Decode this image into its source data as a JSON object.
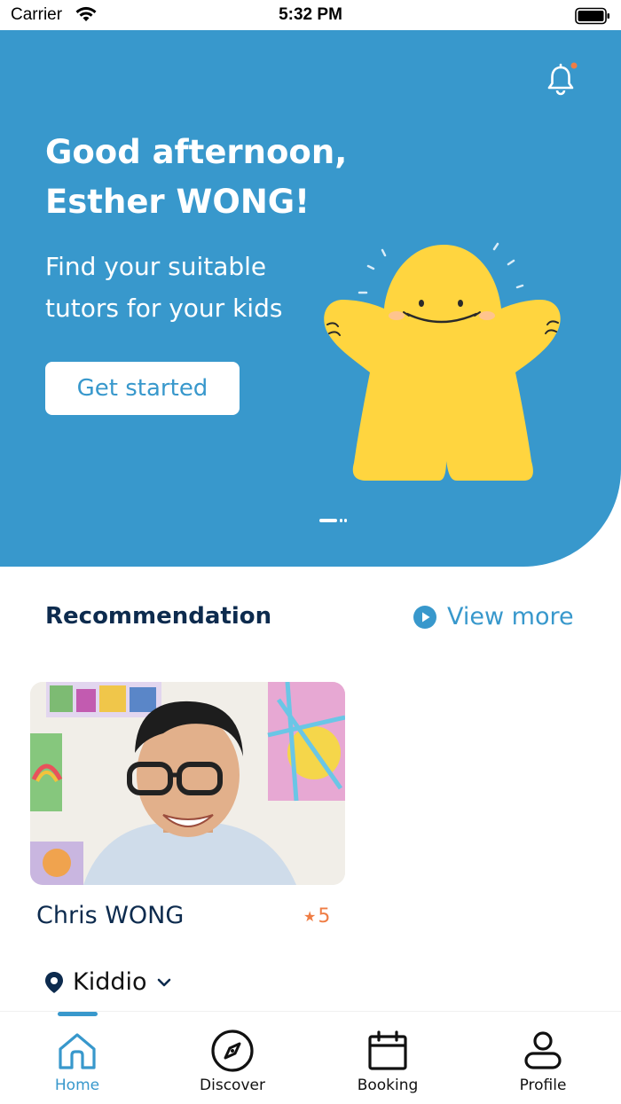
{
  "status_bar": {
    "carrier": "Carrier",
    "time": "5:32 PM"
  },
  "hero": {
    "greeting_line1": "Good afternoon,",
    "greeting_line2": "Esther WONG!",
    "subtitle_line1": "Find your suitable",
    "subtitle_line2": "tutors for your kids",
    "cta_label": "Get started",
    "background_color": "#3898cc",
    "mascot_color": "#ffd53f",
    "notification_dot_color": "#ef7d44"
  },
  "recommendation": {
    "title": "Recommendation",
    "view_more_label": "View more",
    "tutors": [
      {
        "name": "Chris WONG",
        "rating": "5"
      }
    ]
  },
  "location": {
    "name": "Kiddio"
  },
  "tabs": [
    {
      "label": "Home",
      "icon": "home-icon",
      "active": true
    },
    {
      "label": "Discover",
      "icon": "compass-icon",
      "active": false
    },
    {
      "label": "Booking",
      "icon": "calendar-icon",
      "active": false
    },
    {
      "label": "Profile",
      "icon": "person-icon",
      "active": false
    }
  ],
  "colors": {
    "accent": "#3898cc",
    "title": "#0d2b4e",
    "rating": "#ef7d44"
  }
}
